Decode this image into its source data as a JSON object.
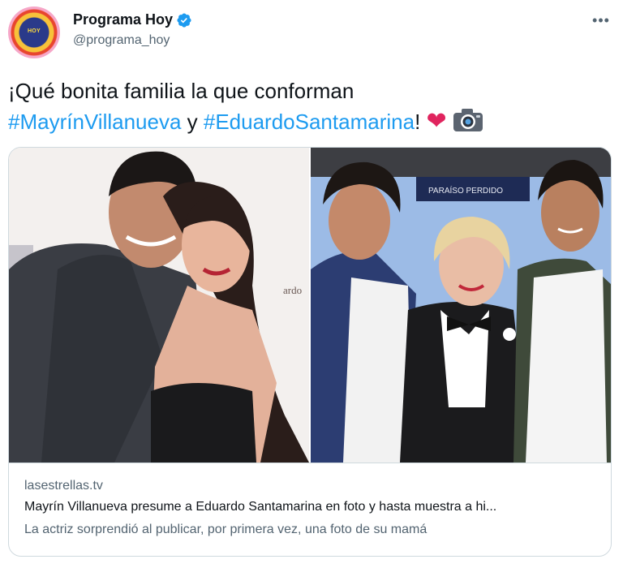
{
  "author": {
    "display_name": "Programa Hoy",
    "handle": "@programa_hoy",
    "avatar_text": "HOY",
    "verified": true
  },
  "menu": {
    "more_label": "•••"
  },
  "tweet": {
    "line1": "¡Qué bonita familia la que conforman",
    "hashtag1": "#MayrínVillanueva",
    "connector": " y ",
    "hashtag2": "#EduardoSantamarina",
    "ending": "! ",
    "heart": "❤"
  },
  "link_card": {
    "domain": "lasestrellas.tv",
    "title": "Mayrín Villanueva presume a Eduardo Santamarina en foto y hasta muestra a hi...",
    "description": "La actriz sorprendió al publicar, por primera vez, una foto de su mamá",
    "photo_sign_text": "PARAÍSO PERDIDO"
  },
  "colors": {
    "hashtag": "#1d9bf0",
    "verified": "#1d9bf0",
    "border": "#cfd9de",
    "secondary_text": "#536471"
  }
}
